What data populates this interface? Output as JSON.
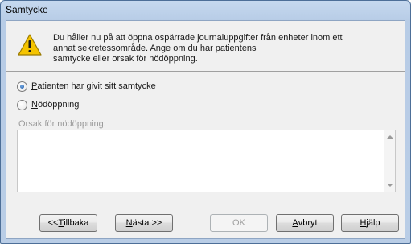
{
  "window": {
    "title": "Samtycke"
  },
  "message": {
    "icon": "warning-icon",
    "lines": [
      "Du håller nu på att öppna ospärrade journaluppgifter från enheter inom ett",
      "annat sekretessområde. Ange om du har patientens",
      "samtycke eller orsak för nödöppning."
    ]
  },
  "options": {
    "consent": {
      "accel": "P",
      "rest": "atienten har givit sitt samtycke",
      "selected": true
    },
    "emergency": {
      "accel": "N",
      "rest": "ödöppning",
      "selected": false
    }
  },
  "reason": {
    "label": "Orsak för nödöppning:",
    "value": ""
  },
  "buttons": {
    "back": {
      "prefix": "<< ",
      "accel": "T",
      "rest": "illbaka"
    },
    "next": {
      "accel": "N",
      "rest": "ästa >>"
    },
    "ok": {
      "label": "OK",
      "enabled": false
    },
    "cancel": {
      "accel": "A",
      "rest": "vbryt"
    },
    "help": {
      "accel": "H",
      "rest": "jälp"
    }
  },
  "colors": {
    "title_bar": "#c6d9ef",
    "warning_yellow": "#f5c400"
  }
}
